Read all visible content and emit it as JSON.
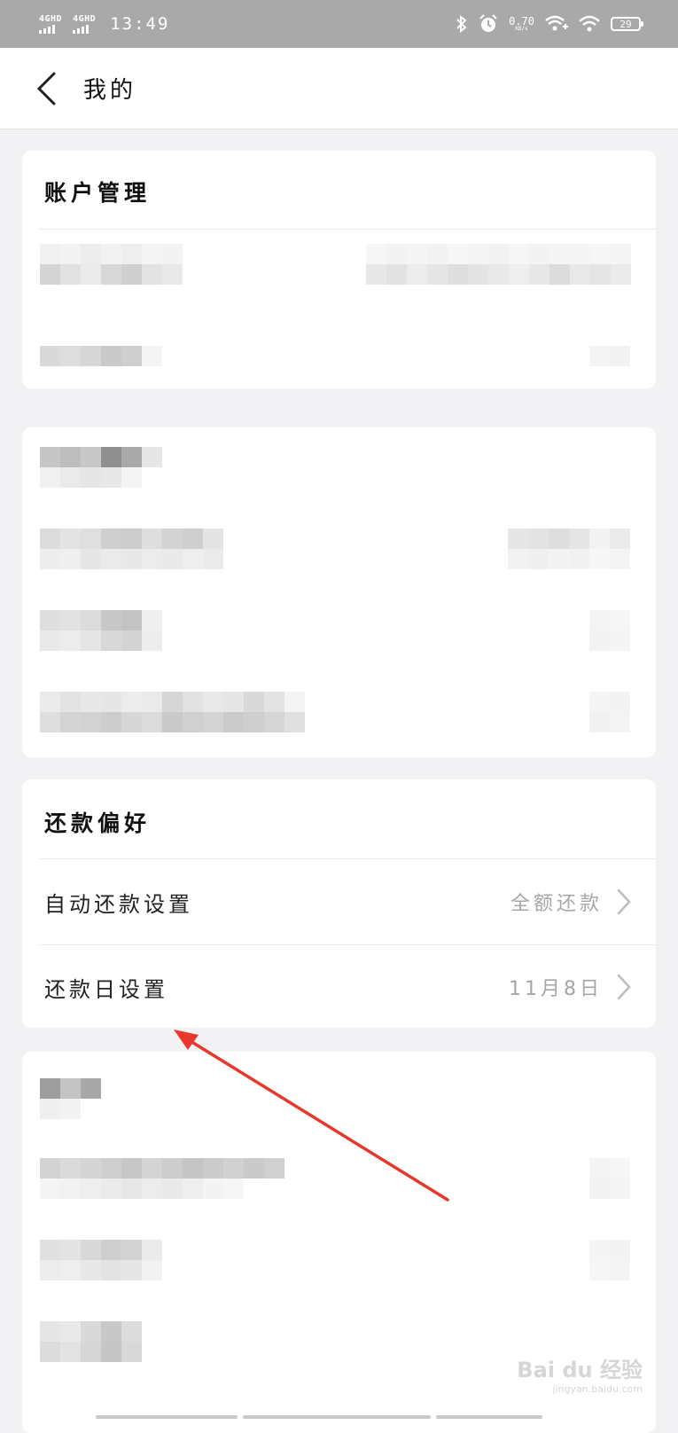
{
  "status_bar": {
    "network_1": "4GHD",
    "network_2": "4GHD",
    "time": "13:49",
    "speed_value": "0.70",
    "speed_unit": "KB/s",
    "battery": "29"
  },
  "header": {
    "title": "我的"
  },
  "account_section": {
    "title": "账户管理"
  },
  "repayment_section": {
    "title": "还款偏好",
    "rows": [
      {
        "label": "自动还款设置",
        "value": "全额还款"
      },
      {
        "label": "还款日设置",
        "value": "11月8日"
      }
    ]
  },
  "watermark": {
    "brand": "Bai du 经验",
    "url": "jingyan.baidu.com"
  },
  "colors": {
    "status_bar": "#a9a9a9",
    "background": "#f2f2f4",
    "card": "#ffffff",
    "annotation_arrow": "#e8382c",
    "value_text": "#a6a6a6"
  }
}
